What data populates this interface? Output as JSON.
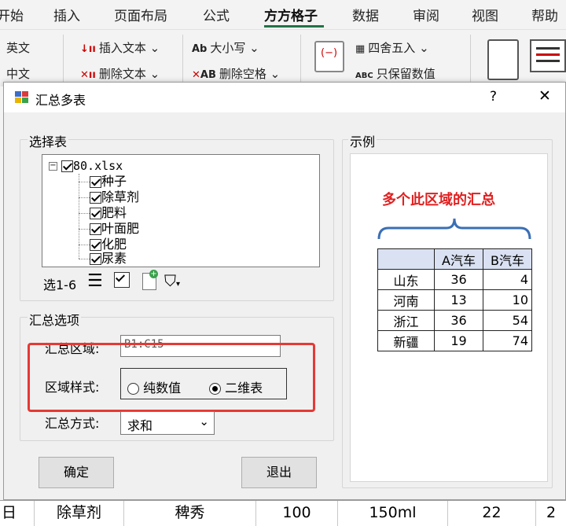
{
  "ribbon": {
    "tabs": [
      "开始",
      "插入",
      "页面布局",
      "公式",
      "方方格子",
      "数据",
      "审阅",
      "视图",
      "帮助"
    ],
    "active_tab": "方方格子",
    "buttons": {
      "english": "英文",
      "chinese": "中文",
      "insert_text": "插入文本",
      "delete_text": "删除文本",
      "case": "大小写",
      "delete_space": "删除空格",
      "round": "四舍五入",
      "keep_value": "只保留数值",
      "abc_label": "ABC"
    }
  },
  "dialog": {
    "title": "汇总多表",
    "help": "?",
    "close": "✕",
    "select_table": {
      "label": "选择表",
      "root": "80.xlsx",
      "sheets": [
        "种子",
        "除草剂",
        "肥料",
        "叶面肥",
        "化肥",
        "尿素"
      ],
      "range_label": "选1-6"
    },
    "options": {
      "label": "汇总选项",
      "area_label": "汇总区域:",
      "area_value": "B1:C15",
      "style_label": "区域样式:",
      "style_options": [
        "纯数值",
        "二维表"
      ],
      "style_selected": "二维表",
      "method_label": "汇总方式:",
      "method_value": "求和"
    },
    "buttons": {
      "ok": "确定",
      "exit": "退出"
    },
    "example": {
      "label": "示例",
      "caption": "多个此区域的汇总",
      "headers": [
        "",
        "A汽车",
        "B汽车"
      ],
      "rows": [
        [
          "山东",
          "36",
          "4"
        ],
        [
          "河南",
          "13",
          "10"
        ],
        [
          "浙江",
          "36",
          "54"
        ],
        [
          "新疆",
          "19",
          "74"
        ]
      ],
      "colors": {
        "caption": "#e02020",
        "brace": "#3a6fb5",
        "header_bg": "#d9e1f2",
        "highlight": "#e53935"
      }
    }
  },
  "sheet_row": [
    "日",
    "除草剂",
    "稗秀",
    "100",
    "150ml",
    "22",
    "2"
  ]
}
